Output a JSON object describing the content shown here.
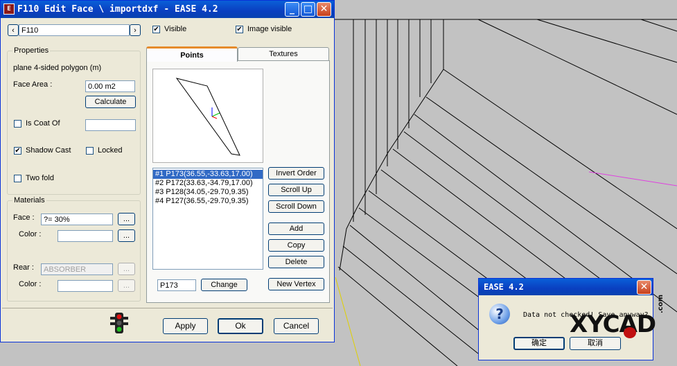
{
  "window": {
    "title": "F110 Edit Face \\ importdxf - EASE 4.2",
    "min_glyph": "_",
    "max_glyph": "□",
    "close_glyph": "✕"
  },
  "nav": {
    "prev": "‹",
    "next": "›",
    "face_id": "F110"
  },
  "checks": {
    "visible": "Visible",
    "image_visible": "Image visible",
    "mark": "✔"
  },
  "properties": {
    "legend": "Properties",
    "type": "plane  4-sided polygon  (m)",
    "face_area_label": "Face Area :",
    "face_area_value": "0.00 m2",
    "calculate": "Calculate",
    "is_coat_of": "Is Coat Of",
    "shadow_cast": "Shadow Cast",
    "locked": "Locked",
    "two_fold": "Two fold"
  },
  "materials": {
    "legend": "Materials",
    "face_label": "Face :",
    "face_value": "?= 30%",
    "color_label": "Color :",
    "rear_label": "Rear :",
    "rear_value": "ABSORBER",
    "color2_label": "Color :",
    "browse": "..."
  },
  "tabs": {
    "points": "Points",
    "textures": "Textures"
  },
  "points": {
    "items": [
      "#1  P173(36.55,-33.63,17.00)",
      "#2  P172(33.63,-34.79,17.00)",
      "#3  P128(34.05,-29.70,9.35)",
      "#4  P127(36.55,-29.70,9.35)"
    ],
    "edit_value": "P173",
    "change": "Change",
    "invert_order": "Invert Order",
    "scroll_up": "Scroll Up",
    "scroll_down": "Scroll Down",
    "add": "Add",
    "copy": "Copy",
    "delete": "Delete",
    "new_vertex": "New Vertex"
  },
  "footer": {
    "apply": "Apply",
    "ok": "Ok",
    "cancel": "Cancel"
  },
  "dialog": {
    "title": "EASE 4.2",
    "close_glyph": "✕",
    "icon_glyph": "?",
    "message": "Data not checked! Save anyway?",
    "confirm": "确定",
    "cancel": "取消"
  },
  "watermark": {
    "text": "XYCAD",
    "suffix": ".com"
  },
  "colors": {
    "accent": "#0a3fc0",
    "selection": "#316ac5",
    "magenta_line": "#e040e0",
    "yellow_line": "#e0d000"
  }
}
